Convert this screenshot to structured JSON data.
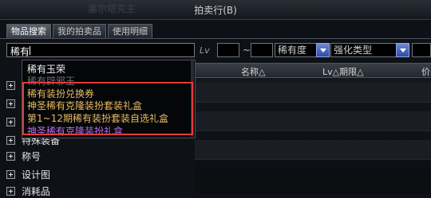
{
  "window": {
    "title": "拍卖行(B)",
    "faint_bg_text": "塞尔塔克主"
  },
  "tabs": [
    {
      "label": "物品搜索"
    },
    {
      "label": "我的拍卖品"
    },
    {
      "label": "使用明细"
    }
  ],
  "search": {
    "value": "稀有"
  },
  "filters": {
    "lv_label": "Lv",
    "lv_separator": "~",
    "rarity_select": "稀有度",
    "enhance_select": "强化类型"
  },
  "columns": {
    "name": "名称△",
    "lv_period": "Lv△期限△",
    "price": "价"
  },
  "categories": [
    {
      "label": "称号"
    },
    {
      "label": "设计图"
    },
    {
      "label": "消耗品"
    },
    {
      "label": "特殊装备"
    }
  ],
  "autocomplete": {
    "items": [
      {
        "label": "稀有玉荣",
        "style": "normal"
      },
      {
        "label": "稀有辟邪玉",
        "style": "dim"
      },
      {
        "label": "稀有装扮兑换券",
        "style": "gold"
      },
      {
        "label": "神圣稀有克隆装扮套装礼盒",
        "style": "gold"
      },
      {
        "label": "第1~12期稀有装扮套装自选礼盒",
        "style": "gold"
      },
      {
        "label": "神圣稀有克隆装扮礼盒",
        "style": "purple"
      }
    ]
  },
  "colors": {
    "highlight_box": "#e23b3b",
    "gold_item": "#e8bd62",
    "purple_item": "#b96ee8",
    "select_arrow": "#2c4da3"
  }
}
